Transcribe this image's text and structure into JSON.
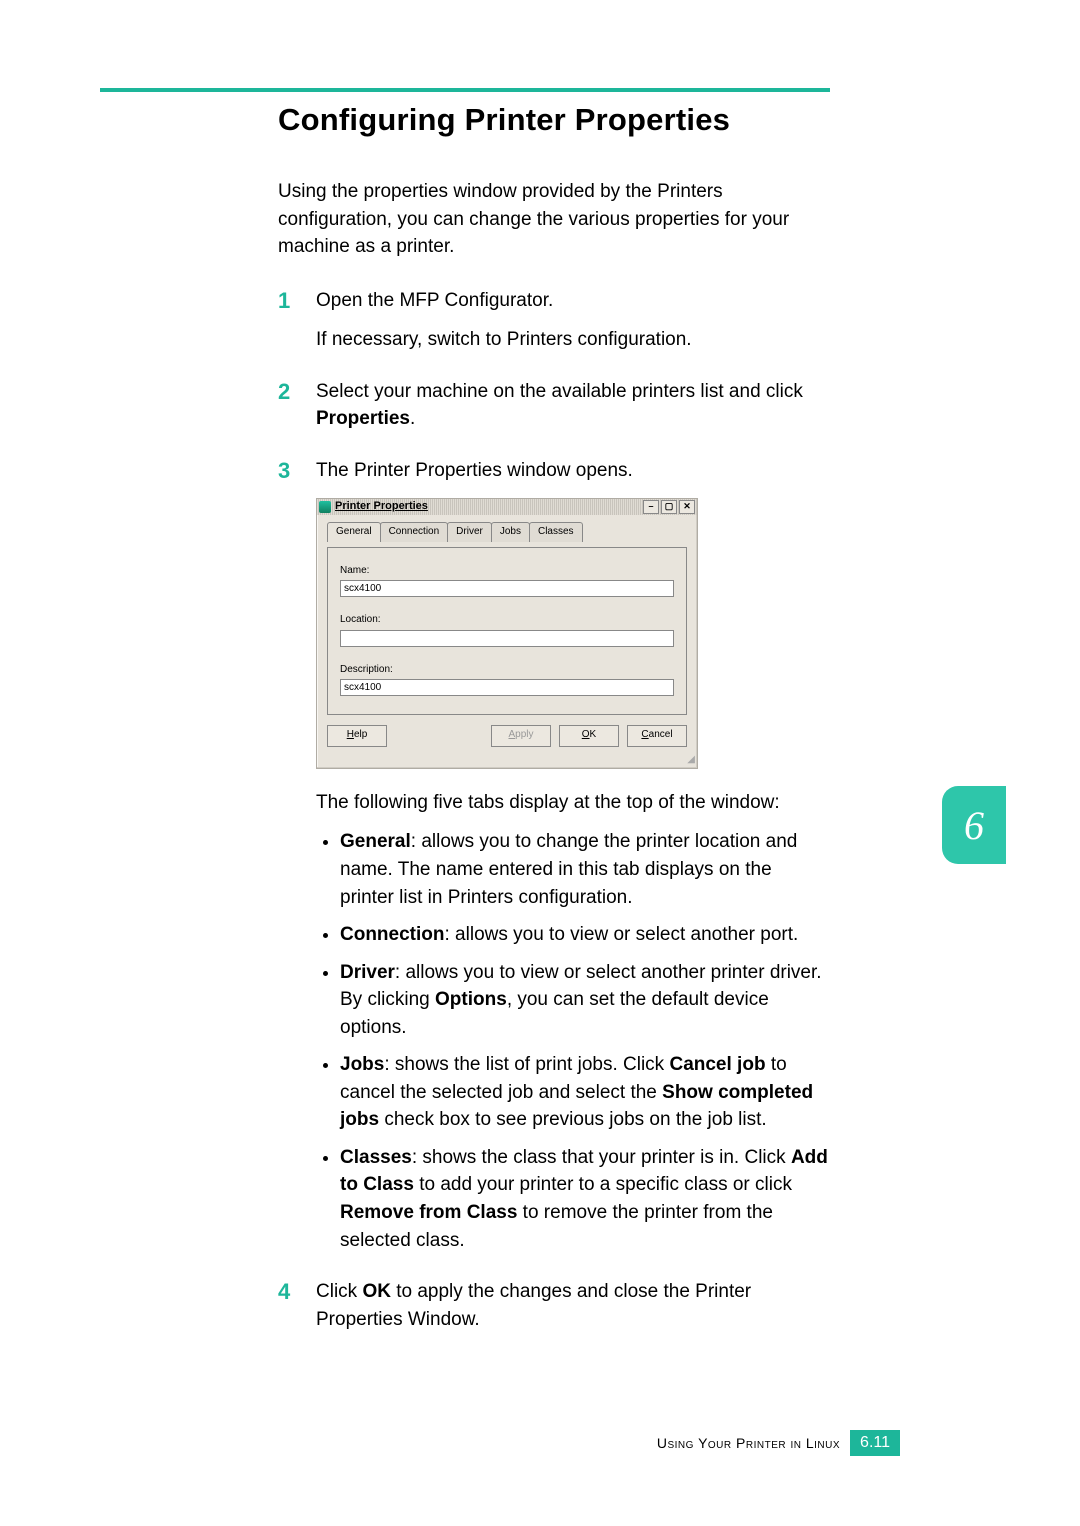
{
  "title": "Configuring Printer Properties",
  "intro": "Using the properties window provided by the Printers configuration, you can change the various properties for your machine as a printer.",
  "steps": {
    "s1a": "Open the MFP Configurator.",
    "s1b": "If necessary, switch to Printers configuration.",
    "s2a": "Select your machine on the available printers list and click ",
    "s2b": "Properties",
    "s2c": ".",
    "s3": "The Printer Properties window opens.",
    "after_fig": "The following five tabs display at the top of the window:",
    "b1a": "General",
    "b1b": ": allows you to change the printer location and name. The name entered in this tab displays on the printer list in Printers configuration.",
    "b2a": "Connection",
    "b2b": ": allows you to view or select another port.",
    "b3a": "Driver",
    "b3b": ": allows you to view or select another printer driver. By clicking ",
    "b3c": "Options",
    "b3d": ", you can set the default device options.",
    "b4a": "Jobs",
    "b4b": ": shows the list of print jobs. Click ",
    "b4c": "Cancel job",
    "b4d": " to cancel the selected job and select the ",
    "b4e": "Show completed jobs",
    "b4f": " check box to see previous jobs on the job list.",
    "b5a": "Classes",
    "b5b": ": shows the class that your printer is in. Click ",
    "b5c": "Add to Class",
    "b5d": " to add your printer to a specific class or click ",
    "b5e": "Remove from Class",
    "b5f": " to remove the printer from the selected class.",
    "s4a": "Click ",
    "s4b": "OK",
    "s4c": " to apply the changes and close the Printer Properties Window."
  },
  "dialog": {
    "title": "Printer Properties",
    "tabs": [
      "General",
      "Connection",
      "Driver",
      "Jobs",
      "Classes"
    ],
    "labels": {
      "name": "Name:",
      "location": "Location:",
      "description": "Description:"
    },
    "values": {
      "name": "scx4100",
      "location": "",
      "description": "scx4100"
    },
    "buttons": {
      "help": "Help",
      "apply": "Apply",
      "ok": "OK",
      "cancel": "Cancel"
    },
    "win": {
      "min": "–",
      "max": "▢",
      "close": "✕"
    }
  },
  "side_tab": "6",
  "footer": {
    "text": "Using Your Printer in Linux",
    "page": "6.11"
  }
}
